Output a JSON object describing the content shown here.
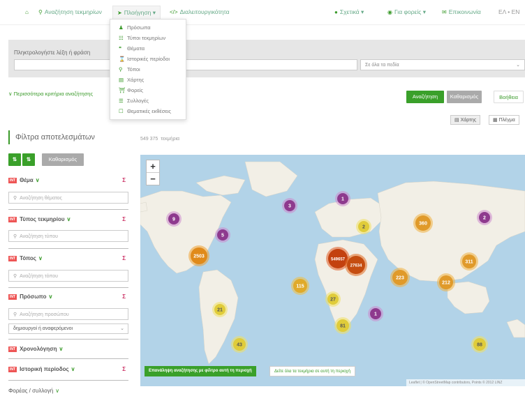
{
  "nav": {
    "home_icon": "home-icon",
    "search_label": "Αναζήτηση τεκμηρίων",
    "browse_label": "Πλοήγηση",
    "interop_label": "Διαλειτουργικότητα",
    "about_label": "Σχετικά",
    "providers_label": "Για φορείς",
    "contact_label": "Επικοινωνία",
    "lang_label": "ΕΛ • EN"
  },
  "browse_menu": {
    "items": [
      {
        "icon": "person-icon",
        "label": "Πρόσωπα"
      },
      {
        "icon": "sitemap-icon",
        "label": "Τύποι τεκμηρίων"
      },
      {
        "icon": "quote-icon",
        "label": "Θέματα"
      },
      {
        "icon": "hourglass-icon",
        "label": "Ιστορικές περίοδοι"
      },
      {
        "icon": "map-marker-icon",
        "label": "Τόποι"
      },
      {
        "icon": "map-icon",
        "label": "Χάρτης"
      },
      {
        "icon": "bank-icon",
        "label": "Φορείς"
      },
      {
        "icon": "collection-icon",
        "label": "Συλλογές"
      },
      {
        "icon": "bookmark-icon",
        "label": "Θεματικές εκθέσεις"
      }
    ]
  },
  "search": {
    "label": "Πληκτρολογήστε λέξη ή φράση",
    "field_select": "Σε όλα τα πεδία",
    "more_criteria": "Περισσότερα κριτήρια αναζήτησης",
    "search_button": "Αναζήτηση",
    "clear_button": "Καθαρισμός",
    "help_button": "Βοήθεια"
  },
  "view": {
    "map_label": "Χάρτης",
    "grid_label": "Πλέγμα"
  },
  "filters": {
    "title": "Φίλτρα αποτελεσμάτων",
    "clear_button": "Καθαρισμός",
    "results_count": "549 375",
    "results_unit": "τεκμήρια",
    "groups": [
      {
        "label": "Θέμα",
        "placeholder": "Αναζήτηση θέματος"
      },
      {
        "label": "Τύπος τεκμηρίου",
        "placeholder": "Αναζήτηση τύπου"
      },
      {
        "label": "Τόπος",
        "placeholder": "Αναζήτηση τόπου"
      },
      {
        "label": "Πρόσωπο",
        "placeholder": "Αναζήτηση προσώπου"
      }
    ],
    "person_role": "δημιουργοί ή αναφερόμενοι",
    "chronology": "Χρονολόγηση",
    "historical_period": "Ιστορική περίοδος",
    "provider": "Φορέας / συλλογή",
    "si_label": "Σ"
  },
  "map": {
    "zoom_in": "+",
    "zoom_out": "−",
    "search_area_button": "Επανάληψη αναζήτησης με φίλτρο αυτή τη περιοχή",
    "see_all_button": "Δείτε όλα τα τεκμήρια σε αυτή τη περιοχή",
    "attribution": "Leaflet | © OpenStreetMap contributors, Points © 2012 LINZ",
    "clusters": [
      {
        "label": "549657"
      },
      {
        "label": "27634"
      },
      {
        "label": "2503"
      },
      {
        "label": "360"
      },
      {
        "label": "311"
      },
      {
        "label": "223"
      },
      {
        "label": "212"
      },
      {
        "label": "115"
      },
      {
        "label": "81"
      },
      {
        "label": "88"
      },
      {
        "label": "43"
      },
      {
        "label": "27"
      },
      {
        "label": "21"
      },
      {
        "label": "2"
      },
      {
        "label": "9"
      },
      {
        "label": "5"
      },
      {
        "label": "3"
      },
      {
        "label": "1"
      },
      {
        "label": "2"
      },
      {
        "label": "1"
      }
    ]
  }
}
